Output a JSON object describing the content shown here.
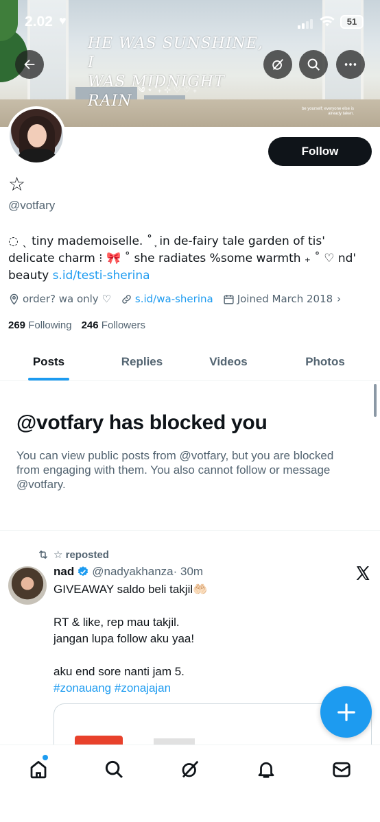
{
  "status_bar": {
    "time": "2.02",
    "battery": "51"
  },
  "banner": {
    "line1": "HE WAS SUNSHINE, I",
    "line2": "WAS MIDNIGHT RAIN",
    "sub": "༄ ⋆ ˚₊ ⊹ ♡ ♡ ₊",
    "note": "be yourself; everyone else is already taken."
  },
  "profile": {
    "display_name": "☆",
    "handle": "@votfary",
    "follow_label": "Follow",
    "bio_text": "◌ ˎ tiny mademoiselle. ˚ ͙ in de-fairy tale garden of tis' delicate charm ⁝ 🎀 ˚ she radiates %some warmth ₊ ˚ ♡ nd' beauty ",
    "bio_link": "s.id/testi-sherina",
    "location": "order? wa only ♡",
    "website": "s.id/wa-sherina",
    "joined": "Joined March 2018",
    "following_count": "269",
    "following_label": "Following",
    "followers_count": "246",
    "followers_label": "Followers"
  },
  "tabs": [
    {
      "label": "Posts",
      "active": true
    },
    {
      "label": "Replies",
      "active": false
    },
    {
      "label": "Videos",
      "active": false
    },
    {
      "label": "Photos",
      "active": false
    }
  ],
  "blocked": {
    "title": "@votfary has blocked you",
    "text": "You can view public posts from @votfary, but you are blocked from engaging with them. You also cannot follow or message @votfary."
  },
  "post": {
    "repost_label": "☆ reposted",
    "name": "nad",
    "handle": "@nadyakhanza",
    "time": "· 30m",
    "lines": [
      "GIVEAWAY saldo beli takjil🤲🏻",
      "",
      "RT & like, rep mau takjil.",
      "jangan lupa follow aku  yaa!",
      "",
      "aku end sore nanti jam 5."
    ],
    "hashtags": "#zonauang #zonajajan"
  },
  "icons": {
    "back": "back-arrow-icon",
    "grok": "grok-icon",
    "search": "search-icon",
    "more": "more-icon",
    "location": "location-pin-icon",
    "link": "link-icon",
    "calendar": "calendar-icon",
    "repost": "repost-icon",
    "verified": "verified-badge-icon",
    "x": "x-logo-icon",
    "compose": "plus-icon",
    "home": "home-icon",
    "notifications": "bell-icon",
    "messages": "mail-icon"
  },
  "colors": {
    "accent": "#1d9bf0",
    "text": "#0f1419",
    "muted": "#536471"
  }
}
